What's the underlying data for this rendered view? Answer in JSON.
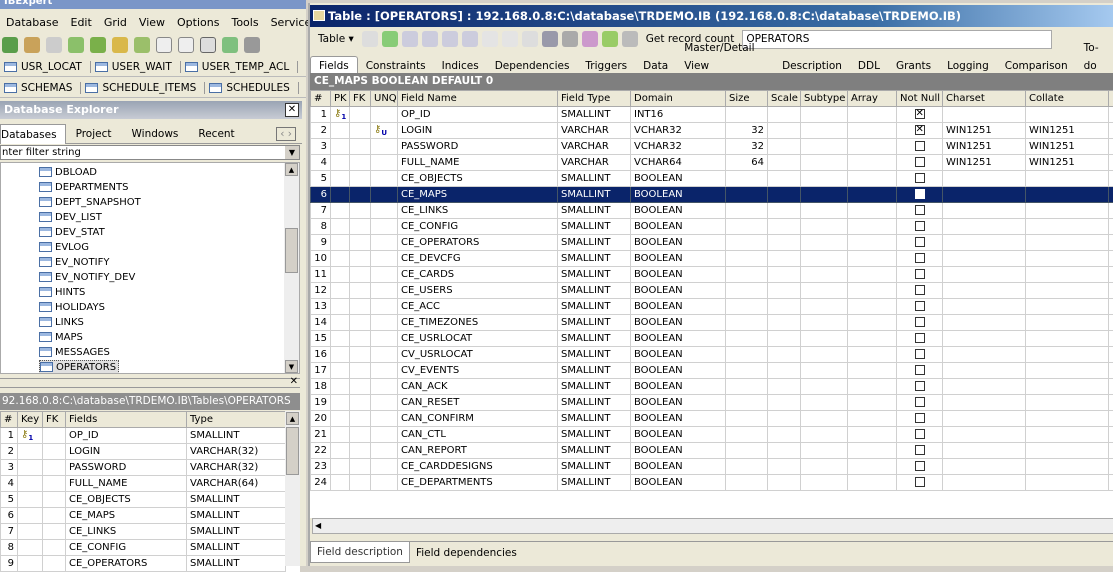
{
  "app": {
    "title": "IBExpert",
    "menu": [
      "Database",
      "Edit",
      "Grid",
      "View",
      "Options",
      "Tools",
      "Services"
    ]
  },
  "quick_tabs_row1": [
    "USR_LOCAT",
    "USER_WAIT",
    "USER_TEMP_ACL"
  ],
  "quick_tabs_row2": [
    "SCHEMAS",
    "SCHEDULE_ITEMS",
    "SCHEDULES"
  ],
  "explorer": {
    "title": "Database Explorer",
    "tabs": [
      "Databases",
      "Project",
      "Windows",
      "Recent"
    ],
    "filter_placeholder": "nter filter string",
    "items": [
      "DBLOAD",
      "DEPARTMENTS",
      "DEPT_SNAPSHOT",
      "DEV_LIST",
      "DEV_STAT",
      "EVLOG",
      "EV_NOTIFY",
      "EV_NOTIFY_DEV",
      "HINTS",
      "HOLIDAYS",
      "LINKS",
      "MAPS",
      "MESSAGES",
      "OPERATORS"
    ],
    "selected": "OPERATORS"
  },
  "fields_panel": {
    "path": "92.168.0.8:C:\\database\\TRDEMO.IB\\Tables\\OPERATORS",
    "columns": [
      "#",
      "Key",
      "FK",
      "Fields",
      "Type"
    ],
    "rows": [
      [
        "1",
        "1",
        "",
        "OP_ID",
        "SMALLINT"
      ],
      [
        "2",
        "",
        "",
        "LOGIN",
        "VARCHAR(32)"
      ],
      [
        "3",
        "",
        "",
        "PASSWORD",
        "VARCHAR(32)"
      ],
      [
        "4",
        "",
        "",
        "FULL_NAME",
        "VARCHAR(64)"
      ],
      [
        "5",
        "",
        "",
        "CE_OBJECTS",
        "SMALLINT"
      ],
      [
        "6",
        "",
        "",
        "CE_MAPS",
        "SMALLINT"
      ],
      [
        "7",
        "",
        "",
        "CE_LINKS",
        "SMALLINT"
      ],
      [
        "8",
        "",
        "",
        "CE_CONFIG",
        "SMALLINT"
      ],
      [
        "9",
        "",
        "",
        "CE_OPERATORS",
        "SMALLINT"
      ]
    ]
  },
  "table_window": {
    "title": "Table : [OPERATORS] : 192.168.0.8:C:\\database\\TRDEMO.IB (192.168.0.8:C:\\database\\TRDEMO.IB)",
    "toolbar": {
      "table_menu": "Table ▾",
      "get_record_count": "Get record count",
      "table_name": "OPERATORS"
    },
    "tabs": [
      "Fields",
      "Constraints",
      "Indices",
      "Dependencies",
      "Triggers",
      "Data",
      "Master/Detail View",
      "Description",
      "DDL",
      "Grants",
      "Logging",
      "Comparison",
      "To-do"
    ],
    "active_tab": "Fields",
    "info": "CE_MAPS BOOLEAN DEFAULT 0",
    "columns": [
      "#",
      "PK",
      "FK",
      "UNQ",
      "Field Name",
      "Field Type",
      "Domain",
      "Size",
      "Scale",
      "Subtype",
      "Array",
      "Not Null",
      "Charset",
      "Collate"
    ],
    "rows": [
      {
        "n": "1",
        "pk": "1",
        "unq": "",
        "name": "OP_ID",
        "type": "SMALLINT",
        "domain": "INT16",
        "size": "",
        "notnull": true,
        "charset": "",
        "collate": ""
      },
      {
        "n": "2",
        "pk": "",
        "unq": "U",
        "name": "LOGIN",
        "type": "VARCHAR",
        "domain": "VCHAR32",
        "size": "32",
        "notnull": true,
        "charset": "WIN1251",
        "collate": "WIN1251"
      },
      {
        "n": "3",
        "pk": "",
        "unq": "",
        "name": "PASSWORD",
        "type": "VARCHAR",
        "domain": "VCHAR32",
        "size": "32",
        "notnull": false,
        "charset": "WIN1251",
        "collate": "WIN1251"
      },
      {
        "n": "4",
        "pk": "",
        "unq": "",
        "name": "FULL_NAME",
        "type": "VARCHAR",
        "domain": "VCHAR64",
        "size": "64",
        "notnull": false,
        "charset": "WIN1251",
        "collate": "WIN1251"
      },
      {
        "n": "5",
        "name": "CE_OBJECTS",
        "type": "SMALLINT",
        "domain": "BOOLEAN"
      },
      {
        "n": "6",
        "name": "CE_MAPS",
        "type": "SMALLINT",
        "domain": "BOOLEAN",
        "selected": true
      },
      {
        "n": "7",
        "name": "CE_LINKS",
        "type": "SMALLINT",
        "domain": "BOOLEAN"
      },
      {
        "n": "8",
        "name": "CE_CONFIG",
        "type": "SMALLINT",
        "domain": "BOOLEAN"
      },
      {
        "n": "9",
        "name": "CE_OPERATORS",
        "type": "SMALLINT",
        "domain": "BOOLEAN"
      },
      {
        "n": "10",
        "name": "CE_DEVCFG",
        "type": "SMALLINT",
        "domain": "BOOLEAN"
      },
      {
        "n": "11",
        "name": "CE_CARDS",
        "type": "SMALLINT",
        "domain": "BOOLEAN"
      },
      {
        "n": "12",
        "name": "CE_USERS",
        "type": "SMALLINT",
        "domain": "BOOLEAN"
      },
      {
        "n": "13",
        "name": "CE_ACC",
        "type": "SMALLINT",
        "domain": "BOOLEAN"
      },
      {
        "n": "14",
        "name": "CE_TIMEZONES",
        "type": "SMALLINT",
        "domain": "BOOLEAN"
      },
      {
        "n": "15",
        "name": "CE_USRLOCAT",
        "type": "SMALLINT",
        "domain": "BOOLEAN"
      },
      {
        "n": "16",
        "name": "CV_USRLOCAT",
        "type": "SMALLINT",
        "domain": "BOOLEAN"
      },
      {
        "n": "17",
        "name": "CV_EVENTS",
        "type": "SMALLINT",
        "domain": "BOOLEAN"
      },
      {
        "n": "18",
        "name": "CAN_ACK",
        "type": "SMALLINT",
        "domain": "BOOLEAN"
      },
      {
        "n": "19",
        "name": "CAN_RESET",
        "type": "SMALLINT",
        "domain": "BOOLEAN"
      },
      {
        "n": "20",
        "name": "CAN_CONFIRM",
        "type": "SMALLINT",
        "domain": "BOOLEAN"
      },
      {
        "n": "21",
        "name": "CAN_CTL",
        "type": "SMALLINT",
        "domain": "BOOLEAN"
      },
      {
        "n": "22",
        "name": "CAN_REPORT",
        "type": "SMALLINT",
        "domain": "BOOLEAN"
      },
      {
        "n": "23",
        "name": "CE_CARDDESIGNS",
        "type": "SMALLINT",
        "domain": "BOOLEAN"
      },
      {
        "n": "24",
        "name": "CE_DEPARTMENTS",
        "type": "SMALLINT",
        "domain": "BOOLEAN"
      }
    ],
    "bottom_tabs": [
      "Field description",
      "Field dependencies"
    ]
  },
  "colors": {
    "title_bar": "#0a246a",
    "selection": "#0a246a",
    "info_bar": "#7f7f7f"
  }
}
